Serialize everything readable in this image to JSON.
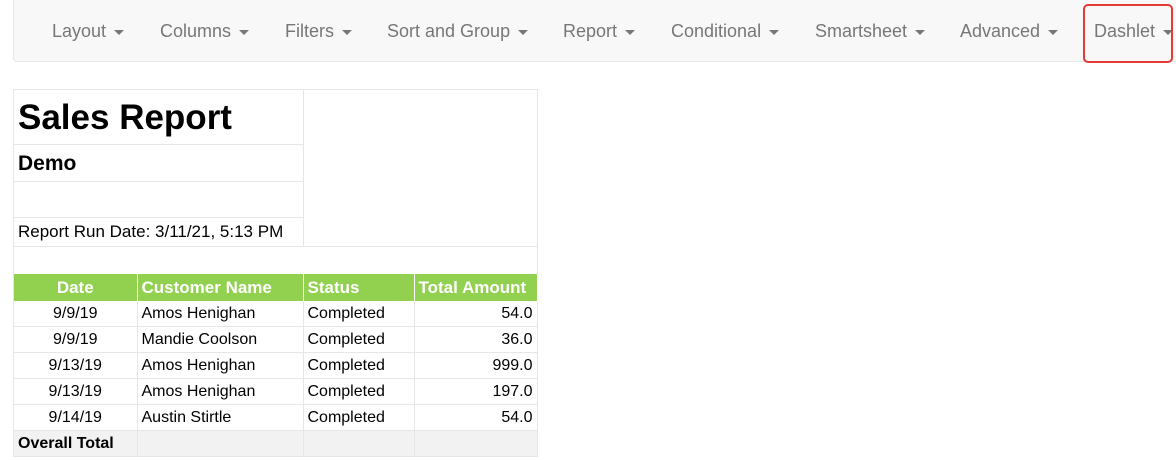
{
  "navbar": {
    "items": [
      {
        "label": "Layout"
      },
      {
        "label": "Columns"
      },
      {
        "label": "Filters"
      },
      {
        "label": "Sort and Group"
      },
      {
        "label": "Report"
      },
      {
        "label": "Conditional"
      },
      {
        "label": "Smartsheet"
      },
      {
        "label": "Advanced"
      },
      {
        "label": "Dashlet"
      }
    ],
    "highlighted_item": "Dashlet",
    "highlight_color": "#e53935"
  },
  "report": {
    "title": "Sales Report",
    "subtitle": "Demo",
    "run_date": "Report Run Date: 3/11/21, 5:13 PM",
    "header_color": "#92d050",
    "columns": [
      "Date",
      "Customer Name",
      "Status",
      "Total Amount"
    ],
    "rows": [
      {
        "date": "9/9/19",
        "customer": "Amos Henighan",
        "status": "Completed",
        "amount": "54.0"
      },
      {
        "date": "9/9/19",
        "customer": "Mandie Coolson",
        "status": "Completed",
        "amount": "36.0"
      },
      {
        "date": "9/13/19",
        "customer": "Amos Henighan",
        "status": "Completed",
        "amount": "999.0"
      },
      {
        "date": "9/13/19",
        "customer": "Amos Henighan",
        "status": "Completed",
        "amount": "197.0"
      },
      {
        "date": "9/14/19",
        "customer": "Austin Stirtle",
        "status": "Completed",
        "amount": "54.0"
      }
    ],
    "total_label": "Overall Total"
  }
}
